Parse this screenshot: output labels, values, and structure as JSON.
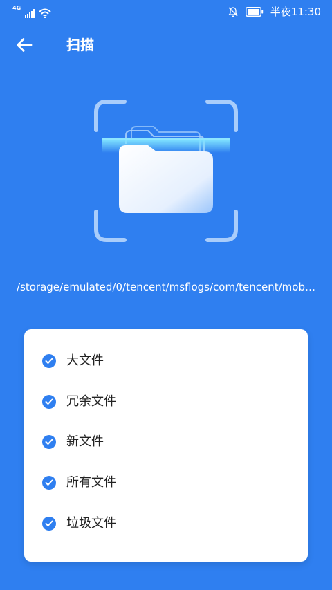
{
  "status_bar": {
    "network": "4G",
    "time": "半夜11:30",
    "icons": [
      "signal-icon",
      "wifi-icon",
      "notifications-off-icon",
      "battery-icon"
    ]
  },
  "header": {
    "title": "扫描",
    "back_icon": "arrow-left-icon"
  },
  "scan": {
    "current_path": "/storage/emulated/0/tencent/msflogs/com/tencent/mob…",
    "illustration_icon": "folder-scan-icon"
  },
  "options": [
    {
      "label": "大文件",
      "checked": true
    },
    {
      "label": "冗余文件",
      "checked": true
    },
    {
      "label": "新文件",
      "checked": true
    },
    {
      "label": "所有文件",
      "checked": true
    },
    {
      "label": "垃圾文件",
      "checked": true
    }
  ],
  "colors": {
    "background": "#2f7ff0",
    "card": "#ffffff",
    "check": "#2f7ff0",
    "text_dark": "#222222"
  }
}
